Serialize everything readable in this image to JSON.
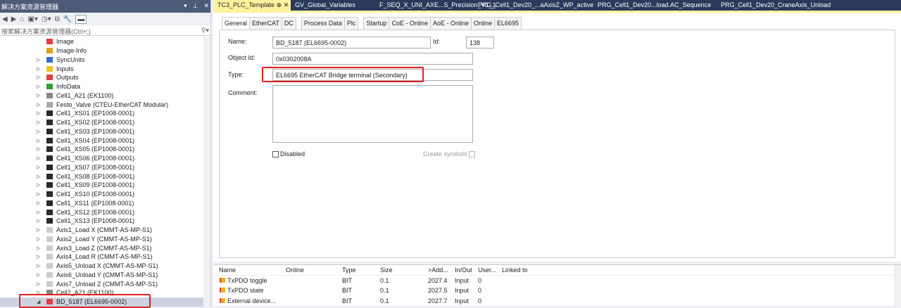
{
  "solution_explorer": {
    "title": "解决方案资源管理器",
    "search_placeholder": "搜索解决方案资源管理器(Ctrl+;)",
    "tree": [
      {
        "label": "Image",
        "icon": "image-icon",
        "exp": false
      },
      {
        "label": "Image-Info",
        "icon": "image-info-icon",
        "exp": false
      },
      {
        "label": "SyncUnits",
        "icon": "sync-icon",
        "exp": true
      },
      {
        "label": "Inputs",
        "icon": "inputs-icon",
        "exp": true
      },
      {
        "label": "Outputs",
        "icon": "outputs-icon",
        "exp": true
      },
      {
        "label": "InfoData",
        "icon": "infodata-icon",
        "exp": true
      },
      {
        "label": "Cell1_A21 (EK1100)",
        "icon": "coupler-icon",
        "exp": true
      },
      {
        "label": "Festo_Valve (CTEU-EtherCAT Modular)",
        "icon": "device-icon",
        "exp": true
      },
      {
        "label": "Cell1_XS01 (EP1008-0001)",
        "icon": "box-icon",
        "exp": true
      },
      {
        "label": "Cell1_XS02 (EP1008-0001)",
        "icon": "box-icon",
        "exp": true
      },
      {
        "label": "Cell1_XS03 (EP1008-0001)",
        "icon": "box-icon",
        "exp": true
      },
      {
        "label": "Cell1_XS04 (EP1008-0001)",
        "icon": "box-icon",
        "exp": true
      },
      {
        "label": "Cell1_XS05 (EP1008-0001)",
        "icon": "box-icon",
        "exp": true
      },
      {
        "label": "Cell1_XS06 (EP1008-0001)",
        "icon": "box-icon",
        "exp": true
      },
      {
        "label": "Cell1_XS07 (EP1008-0001)",
        "icon": "box-icon",
        "exp": true
      },
      {
        "label": "Cell1_XS08 (EP1008-0001)",
        "icon": "box-icon",
        "exp": true
      },
      {
        "label": "Cell1_XS09 (EP1008-0001)",
        "icon": "box-icon",
        "exp": true
      },
      {
        "label": "Cell1_XS10 (EP1008-0001)",
        "icon": "box-icon",
        "exp": true
      },
      {
        "label": "Cell1_XS11 (EP1008-0001)",
        "icon": "box-icon",
        "exp": true
      },
      {
        "label": "Cell1_XS12 (EP1008-0001)",
        "icon": "box-icon",
        "exp": true
      },
      {
        "label": "Cell1_XS13 (EP1008-0001)",
        "icon": "box-icon",
        "exp": true
      },
      {
        "label": "Axis1_Load X (CMMT-AS-MP-S1)",
        "icon": "drive-icon",
        "exp": true
      },
      {
        "label": "Axis2_Load Y (CMMT-AS-MP-S1)",
        "icon": "drive-icon",
        "exp": true
      },
      {
        "label": "Axis3_Load Z (CMMT-AS-MP-S1)",
        "icon": "drive-icon",
        "exp": true
      },
      {
        "label": "Axis4_Load R (CMMT-AS-MP-S1)",
        "icon": "drive-icon",
        "exp": true
      },
      {
        "label": "Axis5_Unload X (CMMT-AS-MP-S1)",
        "icon": "drive-icon",
        "exp": true
      },
      {
        "label": "Axis6_Unload Y (CMMT-AS-MP-S1)",
        "icon": "drive-icon",
        "exp": true
      },
      {
        "label": "Axis7_Unload Z (CMMT-AS-MP-S1)",
        "icon": "drive-icon",
        "exp": true
      },
      {
        "label": "Cell2_A21 (EK1100)",
        "icon": "coupler-icon",
        "exp": true
      },
      {
        "label": "BD_5187 (EL6695-0002)",
        "icon": "bridge-icon",
        "exp": "open",
        "selected": true
      }
    ]
  },
  "editor_tabs": [
    "TC3_PLC_Template",
    "GV_Global_Variables",
    "F_SEQ_X_UNI_AXE...S_Precision_V1_1",
    "PRG_Cell1_Dev20_...aAxisZ_WP_active",
    "PRG_Cell1_Dev20...load.AC_Sequence",
    "PRG_Cell1_Dev20_CraneAxis_Unload"
  ],
  "pin_glyph": "⊕",
  "close_glyph": "✕",
  "sub_tabs": [
    "General",
    "EtherCAT",
    "DC",
    "Process Data",
    "Plc",
    "Startup",
    "CoE - Online",
    "AoE - Online",
    "Online",
    "EL6695"
  ],
  "general": {
    "name_label": "Name:",
    "name": "BD_5187 (EL6695-0002)",
    "id_label": "Id:",
    "id": "138",
    "object_id_label": "Object Id:",
    "object_id": "0x0302008A",
    "type_label": "Type:",
    "type": "EL6695 EtherCAT Bridge terminal (Secondary)",
    "comment_label": "Comment:",
    "comment": "",
    "disabled_label": "Disabled",
    "create_symbols_label": "Create symbols"
  },
  "grid": {
    "columns": [
      "Name",
      "Online",
      "Type",
      "Size",
      ">Add...",
      "In/Out",
      "User...",
      "Linked to"
    ],
    "rows": [
      [
        "TxPDO toggle",
        "",
        "BIT",
        "0.1",
        "2027.4",
        "Input",
        "0",
        ""
      ],
      [
        "TxPDO state",
        "",
        "BIT",
        "0.1",
        "2027.5",
        "Input",
        "0",
        ""
      ],
      [
        "External device...",
        "",
        "BIT",
        "0.1",
        "2027.7",
        "Input",
        "0",
        ""
      ]
    ]
  },
  "colors": {
    "highlight": "#e02020",
    "active_tab": "#fff29d",
    "title_bar": "#4d5a78"
  }
}
